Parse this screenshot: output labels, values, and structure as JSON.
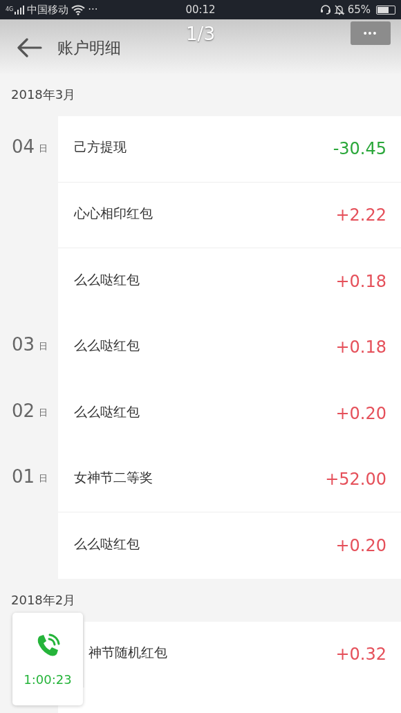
{
  "status_bar": {
    "network": "4G",
    "carrier": "中国移动",
    "more": "···",
    "time": "00:12",
    "battery": "65%"
  },
  "header": {
    "title": "账户明细",
    "page_counter": "1/3",
    "more_button": "•••"
  },
  "months": [
    {
      "label": "2018年3月",
      "days": [
        {
          "day": "04",
          "unit": "日",
          "entries": [
            {
              "name": "己方提现",
              "amount": "-30.45",
              "kind": "out"
            },
            {
              "name": "心心相印红包",
              "amount": "+2.22",
              "kind": "in"
            },
            {
              "name": "么么哒红包",
              "amount": "+0.18",
              "kind": "in"
            }
          ]
        },
        {
          "day": "03",
          "unit": "日",
          "entries": [
            {
              "name": "么么哒红包",
              "amount": "+0.18",
              "kind": "in"
            }
          ]
        },
        {
          "day": "02",
          "unit": "日",
          "entries": [
            {
              "name": "么么哒红包",
              "amount": "+0.20",
              "kind": "in"
            }
          ]
        },
        {
          "day": "01",
          "unit": "日",
          "entries": [
            {
              "name": "女神节二等奖",
              "amount": "+52.00",
              "kind": "in"
            },
            {
              "name": "么么哒红包",
              "amount": "+0.20",
              "kind": "in"
            }
          ]
        }
      ]
    },
    {
      "label": "2018年2月",
      "days": [
        {
          "entries": [
            {
              "name": "神节随机红包",
              "amount": "+0.32",
              "kind": "in"
            }
          ]
        }
      ]
    }
  ],
  "call_widget": {
    "duration": "1:00:23"
  }
}
